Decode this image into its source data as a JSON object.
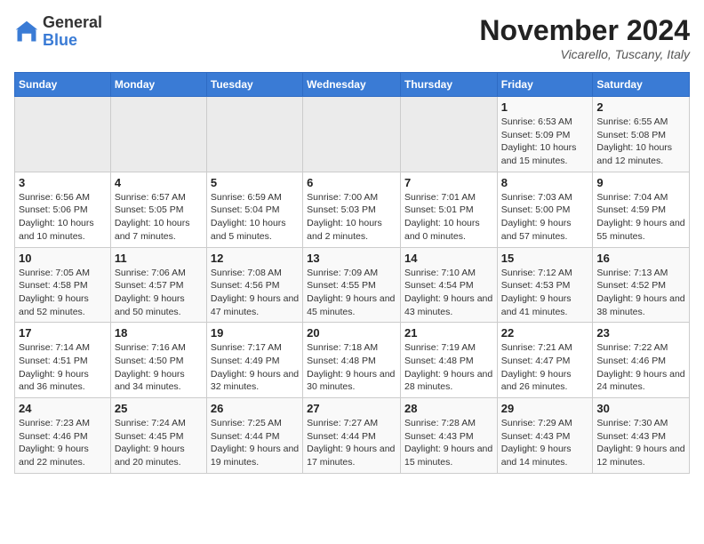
{
  "logo": {
    "general": "General",
    "blue": "Blue"
  },
  "title": "November 2024",
  "location": "Vicarello, Tuscany, Italy",
  "days_of_week": [
    "Sunday",
    "Monday",
    "Tuesday",
    "Wednesday",
    "Thursday",
    "Friday",
    "Saturday"
  ],
  "weeks": [
    [
      {
        "day": "",
        "info": ""
      },
      {
        "day": "",
        "info": ""
      },
      {
        "day": "",
        "info": ""
      },
      {
        "day": "",
        "info": ""
      },
      {
        "day": "",
        "info": ""
      },
      {
        "day": "1",
        "info": "Sunrise: 6:53 AM\nSunset: 5:09 PM\nDaylight: 10 hours and 15 minutes."
      },
      {
        "day": "2",
        "info": "Sunrise: 6:55 AM\nSunset: 5:08 PM\nDaylight: 10 hours and 12 minutes."
      }
    ],
    [
      {
        "day": "3",
        "info": "Sunrise: 6:56 AM\nSunset: 5:06 PM\nDaylight: 10 hours and 10 minutes."
      },
      {
        "day": "4",
        "info": "Sunrise: 6:57 AM\nSunset: 5:05 PM\nDaylight: 10 hours and 7 minutes."
      },
      {
        "day": "5",
        "info": "Sunrise: 6:59 AM\nSunset: 5:04 PM\nDaylight: 10 hours and 5 minutes."
      },
      {
        "day": "6",
        "info": "Sunrise: 7:00 AM\nSunset: 5:03 PM\nDaylight: 10 hours and 2 minutes."
      },
      {
        "day": "7",
        "info": "Sunrise: 7:01 AM\nSunset: 5:01 PM\nDaylight: 10 hours and 0 minutes."
      },
      {
        "day": "8",
        "info": "Sunrise: 7:03 AM\nSunset: 5:00 PM\nDaylight: 9 hours and 57 minutes."
      },
      {
        "day": "9",
        "info": "Sunrise: 7:04 AM\nSunset: 4:59 PM\nDaylight: 9 hours and 55 minutes."
      }
    ],
    [
      {
        "day": "10",
        "info": "Sunrise: 7:05 AM\nSunset: 4:58 PM\nDaylight: 9 hours and 52 minutes."
      },
      {
        "day": "11",
        "info": "Sunrise: 7:06 AM\nSunset: 4:57 PM\nDaylight: 9 hours and 50 minutes."
      },
      {
        "day": "12",
        "info": "Sunrise: 7:08 AM\nSunset: 4:56 PM\nDaylight: 9 hours and 47 minutes."
      },
      {
        "day": "13",
        "info": "Sunrise: 7:09 AM\nSunset: 4:55 PM\nDaylight: 9 hours and 45 minutes."
      },
      {
        "day": "14",
        "info": "Sunrise: 7:10 AM\nSunset: 4:54 PM\nDaylight: 9 hours and 43 minutes."
      },
      {
        "day": "15",
        "info": "Sunrise: 7:12 AM\nSunset: 4:53 PM\nDaylight: 9 hours and 41 minutes."
      },
      {
        "day": "16",
        "info": "Sunrise: 7:13 AM\nSunset: 4:52 PM\nDaylight: 9 hours and 38 minutes."
      }
    ],
    [
      {
        "day": "17",
        "info": "Sunrise: 7:14 AM\nSunset: 4:51 PM\nDaylight: 9 hours and 36 minutes."
      },
      {
        "day": "18",
        "info": "Sunrise: 7:16 AM\nSunset: 4:50 PM\nDaylight: 9 hours and 34 minutes."
      },
      {
        "day": "19",
        "info": "Sunrise: 7:17 AM\nSunset: 4:49 PM\nDaylight: 9 hours and 32 minutes."
      },
      {
        "day": "20",
        "info": "Sunrise: 7:18 AM\nSunset: 4:48 PM\nDaylight: 9 hours and 30 minutes."
      },
      {
        "day": "21",
        "info": "Sunrise: 7:19 AM\nSunset: 4:48 PM\nDaylight: 9 hours and 28 minutes."
      },
      {
        "day": "22",
        "info": "Sunrise: 7:21 AM\nSunset: 4:47 PM\nDaylight: 9 hours and 26 minutes."
      },
      {
        "day": "23",
        "info": "Sunrise: 7:22 AM\nSunset: 4:46 PM\nDaylight: 9 hours and 24 minutes."
      }
    ],
    [
      {
        "day": "24",
        "info": "Sunrise: 7:23 AM\nSunset: 4:46 PM\nDaylight: 9 hours and 22 minutes."
      },
      {
        "day": "25",
        "info": "Sunrise: 7:24 AM\nSunset: 4:45 PM\nDaylight: 9 hours and 20 minutes."
      },
      {
        "day": "26",
        "info": "Sunrise: 7:25 AM\nSunset: 4:44 PM\nDaylight: 9 hours and 19 minutes."
      },
      {
        "day": "27",
        "info": "Sunrise: 7:27 AM\nSunset: 4:44 PM\nDaylight: 9 hours and 17 minutes."
      },
      {
        "day": "28",
        "info": "Sunrise: 7:28 AM\nSunset: 4:43 PM\nDaylight: 9 hours and 15 minutes."
      },
      {
        "day": "29",
        "info": "Sunrise: 7:29 AM\nSunset: 4:43 PM\nDaylight: 9 hours and 14 minutes."
      },
      {
        "day": "30",
        "info": "Sunrise: 7:30 AM\nSunset: 4:43 PM\nDaylight: 9 hours and 12 minutes."
      }
    ]
  ]
}
